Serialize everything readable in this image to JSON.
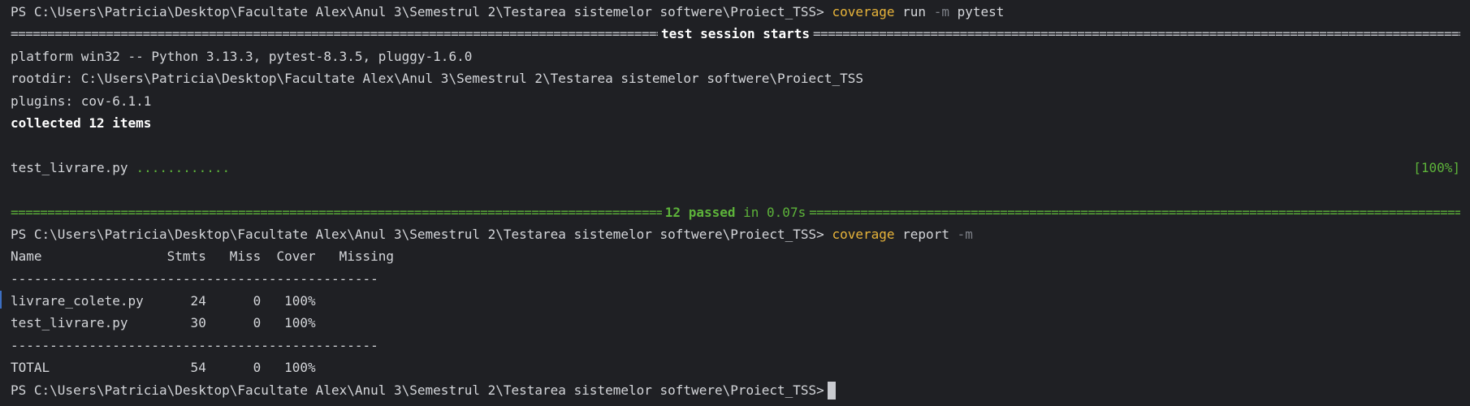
{
  "prompt": "PS C:\\Users\\Patricia\\Desktop\\Facultate Alex\\Anul 3\\Semestrul 2\\Testarea sistemelor softwere\\Proiect_TSS>",
  "command1": {
    "tool": "coverage",
    "args": "run",
    "flag": "-m",
    "target": "pytest"
  },
  "session": {
    "header": "test session starts",
    "platform": "platform win32 -- Python 3.13.3, pytest-8.3.5, pluggy-1.6.0",
    "rootdir": "rootdir: C:\\Users\\Patricia\\Desktop\\Facultate Alex\\Anul 3\\Semestrul 2\\Testarea sistemelor softwere\\Proiect_TSS",
    "plugins": "plugins: cov-6.1.1",
    "collected": "collected 12 items",
    "test_file": "test_livrare.py",
    "dots": "............",
    "percent": "[100%]",
    "passed": "12 passed",
    "duration": "in 0.07s"
  },
  "command2": {
    "tool": "coverage",
    "args": "report",
    "flag": "-m"
  },
  "report": {
    "header": "Name                Stmts   Miss  Cover   Missing",
    "separator": "-----------------------------------------------",
    "rows": [
      "livrare_colete.py      24      0   100%",
      "test_livrare.py        30      0   100%"
    ],
    "total": "TOTAL                  54      0   100%"
  },
  "colors": {
    "background": "#1f2024",
    "text": "#d4d6da",
    "command": "#e8b43a",
    "success": "#5db33a",
    "flag": "#7d8088"
  }
}
